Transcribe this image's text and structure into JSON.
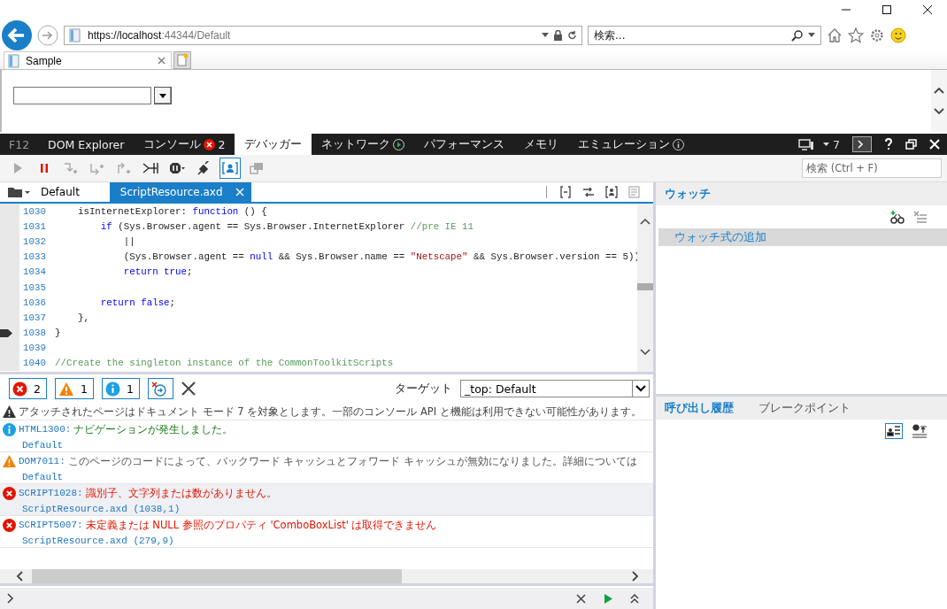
{
  "browser": {
    "url_host": "https://localhost",
    "url_path": ":44344/Default",
    "search_placeholder": "検索...",
    "tabs": [
      {
        "label": "Sample",
        "selected": true
      }
    ]
  },
  "devtools": {
    "label": "F12",
    "tabs": [
      {
        "label": "DOM Explorer",
        "selected": false
      },
      {
        "label": "コンソール",
        "selected": false,
        "kind": "errors",
        "badge": "2"
      },
      {
        "label": "デバッガー",
        "selected": true
      },
      {
        "label": "ネットワーク",
        "selected": false,
        "kind": "recording"
      },
      {
        "label": "パフォーマンス",
        "selected": false
      },
      {
        "label": "メモリ",
        "selected": false
      },
      {
        "label": "エミュレーション",
        "selected": false,
        "kind": "info"
      }
    ],
    "document_mode": "7",
    "toolbar": [
      {
        "kind": "play",
        "disabled": true,
        "selected": false
      },
      {
        "kind": "pause",
        "disabled": false,
        "selected": false
      },
      {
        "kind": "step-into",
        "disabled": true,
        "selected": false
      },
      {
        "kind": "step-over",
        "disabled": true,
        "selected": false
      },
      {
        "kind": "step-out",
        "disabled": true,
        "selected": false
      },
      {
        "kind": "break-worker",
        "disabled": false,
        "selected": false
      },
      {
        "kind": "exceptions",
        "disabled": false,
        "selected": false
      },
      {
        "kind": "disconnect",
        "disabled": false,
        "selected": false
      },
      {
        "kind": "just-my-code",
        "disabled": false,
        "selected": true
      },
      {
        "kind": "panel",
        "disabled": true,
        "selected": false
      }
    ],
    "search_placeholder": "検索 (Ctrl + F)"
  },
  "files": [
    {
      "label": "Default",
      "selected": false
    },
    {
      "label": "ScriptResource.axd",
      "selected": true
    }
  ],
  "code": [
    {
      "number": "1030",
      "current": false,
      "tokens": [
        {
          "kind": "plain",
          "text": "    isInternetExplorer: "
        },
        {
          "kind": "keyword",
          "text": "function"
        },
        {
          "kind": "plain",
          "text": " () {"
        }
      ]
    },
    {
      "number": "1031",
      "current": false,
      "tokens": [
        {
          "kind": "keyword",
          "text": "        if"
        },
        {
          "kind": "plain",
          "text": " (Sys.Browser.agent == Sys.Browser.InternetExplorer "
        },
        {
          "kind": "comment",
          "text": "//pre IE 11"
        }
      ]
    },
    {
      "number": "1032",
      "current": false,
      "tokens": [
        {
          "kind": "plain",
          "text": "            ||"
        }
      ]
    },
    {
      "number": "1033",
      "current": false,
      "tokens": [
        {
          "kind": "plain",
          "text": "            (Sys.Browser.agent == "
        },
        {
          "kind": "keyword",
          "text": "null"
        },
        {
          "kind": "plain",
          "text": " && Sys.Browser.name == "
        },
        {
          "kind": "string",
          "text": "\"Netscape\""
        },
        {
          "kind": "plain",
          "text": " && Sys.Browser.version == 5))"
        }
      ]
    },
    {
      "number": "1034",
      "current": false,
      "tokens": [
        {
          "kind": "keyword",
          "text": "            return true"
        },
        {
          "kind": "plain",
          "text": ";"
        }
      ]
    },
    {
      "number": "1035",
      "current": false
    },
    {
      "number": "1036",
      "current": false,
      "tokens": [
        {
          "kind": "keyword",
          "text": "        return false"
        },
        {
          "kind": "plain",
          "text": ";"
        }
      ]
    },
    {
      "number": "1037",
      "current": false,
      "tokens": [
        {
          "kind": "plain",
          "text": "    },"
        }
      ]
    },
    {
      "number": "1038",
      "current": true,
      "tokens": [
        {
          "kind": "plain",
          "text": "}"
        }
      ]
    },
    {
      "number": "1039",
      "current": false
    },
    {
      "number": "1040",
      "current": false,
      "tokens": [
        {
          "kind": "comment",
          "text": "//Create the singleton instance of the CommonToolkitScripts"
        }
      ]
    }
  ],
  "console": {
    "filters": [
      {
        "kind": "error",
        "count": "2"
      },
      {
        "kind": "warning",
        "count": "1"
      },
      {
        "kind": "info",
        "count": "1"
      }
    ],
    "target_label": "ターゲット",
    "target_value": "_top: Default",
    "messages": [
      {
        "kind": "notice",
        "selected": false,
        "text": "アタッチされたページはドキュメント モード 7 を対象とします。一部のコンソール API と機能は利用できない可能性があります。"
      },
      {
        "kind": "info",
        "selected": false,
        "code": "HTML1300:",
        "text": "ナビゲーションが発生しました。",
        "source": "Default"
      },
      {
        "kind": "warning",
        "selected": false,
        "code": "DOM7011:",
        "text": "このページのコードによって、バックワード キャッシュとフォワード キャッシュが無効になりました。詳細については",
        "source": "Default"
      },
      {
        "kind": "error",
        "selected": true,
        "code": "SCRIPT1028:",
        "text": "識別子、文字列または数がありません。",
        "source": "ScriptResource.axd (1038,1)"
      },
      {
        "kind": "error",
        "selected": false,
        "code": "SCRIPT5007:",
        "text": "未定義または NULL 参照のプロパティ 'ComboBoxList' は取得できません",
        "source": "ScriptResource.axd (279,9)"
      }
    ]
  },
  "watch": {
    "title": "ウォッチ",
    "add_label": "ウォッチ式の追加"
  },
  "call_stack": {
    "tabs": [
      {
        "label": "呼び出し履歴",
        "selected": true
      },
      {
        "label": "ブレークポイント",
        "selected": false
      }
    ]
  }
}
